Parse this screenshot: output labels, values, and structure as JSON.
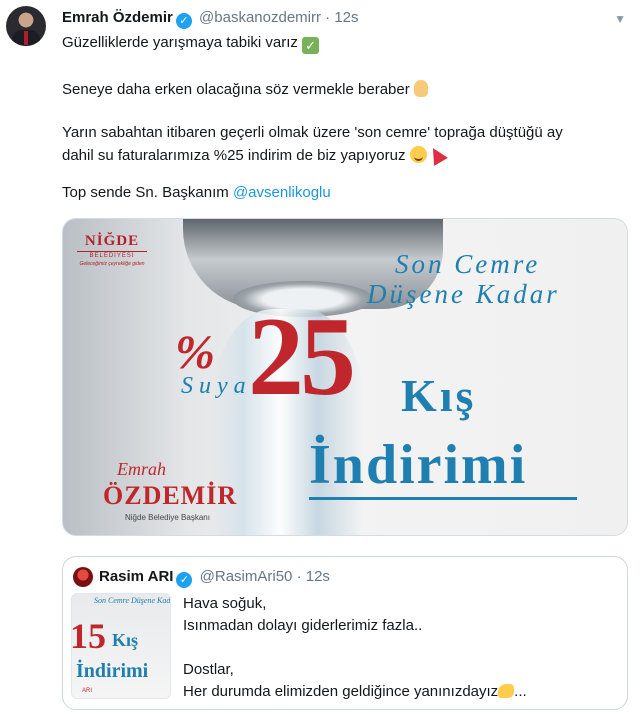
{
  "tweet": {
    "author_name": "Emrah Özdemir",
    "handle": "@baskanozdemirr",
    "separator": "·",
    "time": "12s",
    "lines": {
      "l1": "Güzelliklerde yarışmaya tabiki varız",
      "l2": "Seneye daha erken olacağına söz vermekle beraber",
      "l3": "Yarın sabahtan itibaren geçerli olmak üzere 'son cemre' toprağa düştüğü ay",
      "l4": "dahil su faturalarımıza %25 indirim de biz yapıyoruz",
      "l5_prefix": "Top sende Sn. Başkanım",
      "l5_mention": "@avsenlikoglu"
    },
    "icons": [
      "verified-badge-icon",
      "check-mark-emoji",
      "raised-hand-emoji",
      "smiling-face-emoji",
      "party-popper-emoji",
      "chevron-down-icon"
    ]
  },
  "media": {
    "logo_main": "NİĞDE",
    "logo_sub": "BELEDİYESİ",
    "logo_tag": "Geleceğimiz çeyrekliğe giden",
    "slogan_1": "Son Cemre",
    "slogan_2": "Düşene Kadar",
    "percent_sign": "%",
    "suya": "Suya",
    "number": "25",
    "kis": "Kış",
    "indirimi": "İndirimi",
    "signature_first": "Emrah",
    "signature_last": "ÖZDEMİR",
    "signature_title": "Niğde Belediye Başkanı"
  },
  "quoted_tweet": {
    "author_name": "Rasim ARI",
    "handle": "@RasimAri50",
    "separator": "·",
    "time": "12s",
    "thumb": {
      "slogan": "Son Cemre Düşene Kadar",
      "number": "15",
      "kis": "Kış",
      "indirimi": "İndirimi",
      "signature": "ARI"
    },
    "lines": {
      "l1": "Hava soğuk,",
      "l2": "Isınmadan dolayı giderlerimiz fazla..",
      "l3": "Dostlar,",
      "l4": "Her durumda elimizden geldiğince yanınızdayız",
      "l4_suffix": "..."
    },
    "icons": [
      "verified-badge-icon",
      "flexed-biceps-emoji"
    ]
  },
  "colors": {
    "link_blue": "#1b95e0",
    "verified_blue": "#1da1f2",
    "brand_red": "#c0272d",
    "brand_blue": "#1e7fb0",
    "muted_gray": "#657786"
  }
}
